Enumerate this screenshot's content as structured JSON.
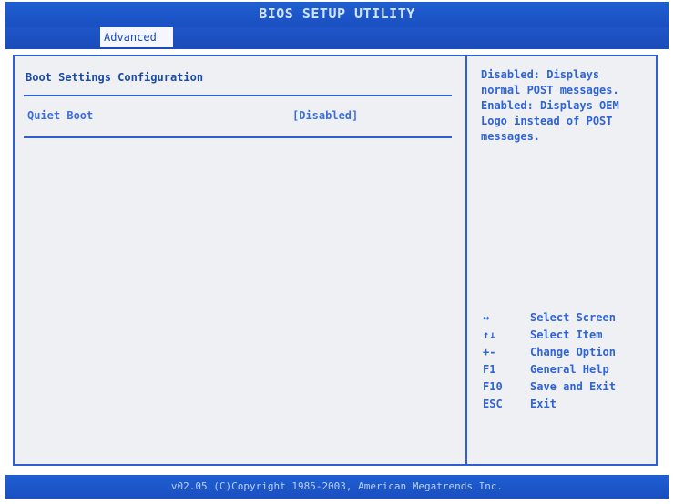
{
  "window": {
    "title": "BIOS SETUP UTILITY"
  },
  "tabs": [
    {
      "label": "Advanced",
      "active": true
    }
  ],
  "main": {
    "section_title": "Boot Settings Configuration",
    "settings": [
      {
        "label": "Quiet Boot",
        "value": "[Disabled]"
      }
    ]
  },
  "help": {
    "lines": [
      "Disabled: Displays",
      "normal POST messages.",
      "Enabled: Displays OEM",
      "Logo instead of POST",
      "messages."
    ]
  },
  "keys": [
    {
      "key": "↔",
      "desc": "Select Screen"
    },
    {
      "key": "↑↓",
      "desc": "Select Item"
    },
    {
      "key": "+-",
      "desc": "Change Option"
    },
    {
      "key": "F1",
      "desc": "General Help"
    },
    {
      "key": "F10",
      "desc": "Save and Exit"
    },
    {
      "key": "ESC",
      "desc": "Exit"
    }
  ],
  "footer": {
    "text": "v02.05 (C)Copyright 1985-2003, American Megatrends Inc."
  },
  "colors": {
    "accent": "#1f5fd2",
    "panel": "#eef0f4",
    "text": "#2f63d6"
  }
}
